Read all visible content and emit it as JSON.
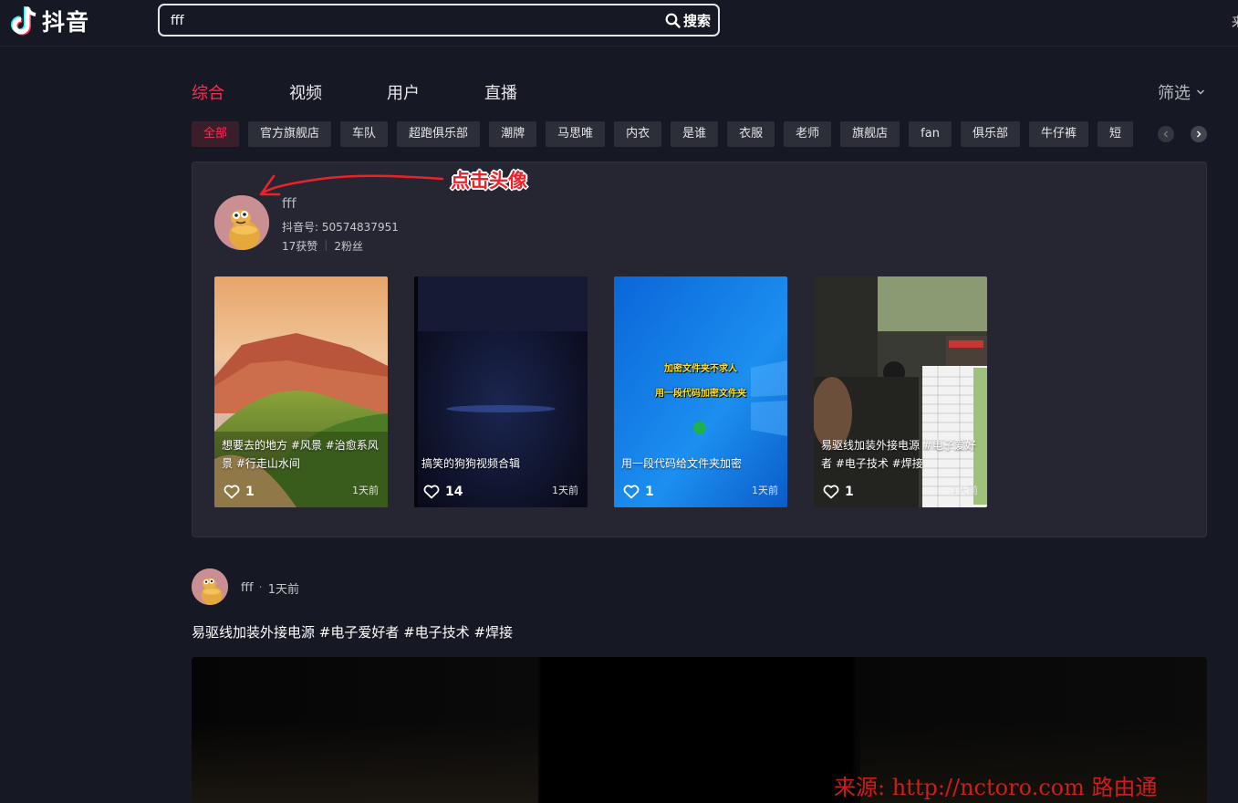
{
  "app": {
    "name": "抖音"
  },
  "search": {
    "value": "fff",
    "button_label": "搜索"
  },
  "top_right_text": "来",
  "tabs": [
    {
      "label": "综合",
      "active": true
    },
    {
      "label": "视频",
      "active": false
    },
    {
      "label": "用户",
      "active": false
    },
    {
      "label": "直播",
      "active": false
    }
  ],
  "filter_label": "筛选",
  "chips": [
    "全部",
    "官方旗舰店",
    "车队",
    "超跑俱乐部",
    "潮牌",
    "马思唯",
    "内衣",
    "是谁",
    "衣服",
    "老师",
    "旗舰店",
    "fan",
    "俱乐部",
    "牛仔裤",
    "短"
  ],
  "user_card": {
    "name": "fff",
    "id_label": "抖音号: ",
    "id_value": "50574837951",
    "likes": "17获赞",
    "fans": "2粉丝",
    "videos": [
      {
        "title": "想要去的地方 #风景 #治愈系风景 #行走山水间",
        "likes": "1",
        "time": "1天前"
      },
      {
        "title": "搞笑的狗狗视频合辑",
        "likes": "14",
        "time": "1天前"
      },
      {
        "title": "用一段代码给文件夹加密",
        "likes": "1",
        "time": "1天前",
        "overlay_line1": "加密文件夹不求人",
        "overlay_line2": "用一段代码加密文件夹"
      },
      {
        "title": "易驱线加装外接电源 #电子爱好者 #电子技术 #焊接",
        "likes": "1",
        "time": "1天前"
      }
    ]
  },
  "annotation": "点击头像",
  "post": {
    "author": "fff",
    "time": "1天前",
    "title": "易驱线加装外接电源 #电子爱好者 #电子技术 #焊接"
  },
  "watermark": "来源: http://nctoro.com 路由通",
  "colors": {
    "background": "#161823",
    "accent": "#fe2c55",
    "card": "#252632",
    "chip": "#2c2e38"
  }
}
